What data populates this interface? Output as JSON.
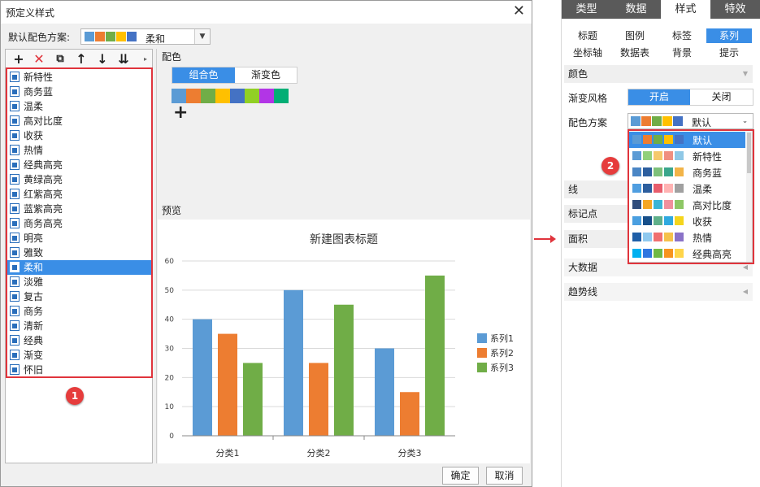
{
  "dialog": {
    "title": "预定义样式",
    "scheme_label": "默认配色方案:",
    "scheme_value": "柔和",
    "scheme_colors": [
      "#5b9bd5",
      "#ed7d31",
      "#70ad47",
      "#ffc000",
      "#4472c4"
    ],
    "color_section": "配色",
    "tab_combo": "组合色",
    "tab_gradient": "渐变色",
    "palette": [
      "#5b9bd5",
      "#ed7d31",
      "#70ad47",
      "#ffc000",
      "#4472c4",
      "#91d024",
      "#b235e6",
      "#02ae75"
    ],
    "preview_label": "预览",
    "ok": "确定",
    "cancel": "取消",
    "styles": [
      "新特性",
      "商务蓝",
      "温柔",
      "高对比度",
      "收获",
      "热情",
      "经典高亮",
      "黄绿高亮",
      "红紫高亮",
      "蓝紫高亮",
      "商务高亮",
      "明亮",
      "雅致",
      "柔和",
      "淡雅",
      "复古",
      "商务",
      "清新",
      "经典",
      "渐变",
      "怀旧"
    ],
    "selected_style": "柔和"
  },
  "badges": {
    "b1": "1",
    "b2": "2"
  },
  "chart_data": {
    "type": "bar",
    "title": "新建图表标题",
    "categories": [
      "分类1",
      "分类2",
      "分类3"
    ],
    "series": [
      {
        "name": "系列1",
        "values": [
          40,
          50,
          30
        ],
        "color": "#5b9bd5"
      },
      {
        "name": "系列2",
        "values": [
          35,
          25,
          15
        ],
        "color": "#ed7d31"
      },
      {
        "name": "系列3",
        "values": [
          25,
          45,
          55
        ],
        "color": "#70ad47"
      }
    ],
    "ylim": [
      0,
      60
    ],
    "yticks": [
      0,
      10,
      20,
      30,
      40,
      50,
      60
    ],
    "grid": true,
    "legend": "right"
  },
  "panel": {
    "tabs": [
      "类型",
      "数据",
      "样式",
      "特效"
    ],
    "active_tab": "样式",
    "subtabs": [
      "标题",
      "图例",
      "标签",
      "系列",
      "坐标轴",
      "数据表",
      "背景",
      "提示"
    ],
    "active_subtab": "系列",
    "color_section": "颜色",
    "gradient_style": "渐变风格",
    "toggle_on": "开启",
    "toggle_off": "关闭",
    "scheme_label": "配色方案",
    "scheme_value": "默认",
    "sections": [
      "线",
      "标记点",
      "面积",
      "大数据",
      "趋势线"
    ],
    "dropdown": [
      {
        "name": "默认",
        "colors": [
          "#5b9bd5",
          "#ed7d31",
          "#70ad47",
          "#ffc000",
          "#4472c4"
        ]
      },
      {
        "name": "新特性",
        "colors": [
          "#5b9bd5",
          "#91d07b",
          "#f6c96b",
          "#f08f7f",
          "#8fc8e6"
        ]
      },
      {
        "name": "商务蓝",
        "colors": [
          "#4a86c5",
          "#2c5e9e",
          "#7dc07a",
          "#3aa68c",
          "#f2b448"
        ]
      },
      {
        "name": "温柔",
        "colors": [
          "#4f9ee0",
          "#2c5e9e",
          "#e85d6c",
          "#ffb3b3",
          "#a0a0a0"
        ]
      },
      {
        "name": "高对比度",
        "colors": [
          "#2f4d7c",
          "#f5a623",
          "#3bb4d6",
          "#f08f9c",
          "#8dc765"
        ]
      },
      {
        "name": "收获",
        "colors": [
          "#4a9fe0",
          "#174f8a",
          "#5fb08a",
          "#2fa9e0",
          "#f5d51c"
        ]
      },
      {
        "name": "热情",
        "colors": [
          "#1f5fa8",
          "#8fc9ef",
          "#f07070",
          "#f5c14b",
          "#8a72c8"
        ]
      },
      {
        "name": "经典高亮",
        "colors": [
          "#00b0f0",
          "#2f76e0",
          "#70b945",
          "#f7941d",
          "#ffd54a"
        ]
      }
    ]
  }
}
